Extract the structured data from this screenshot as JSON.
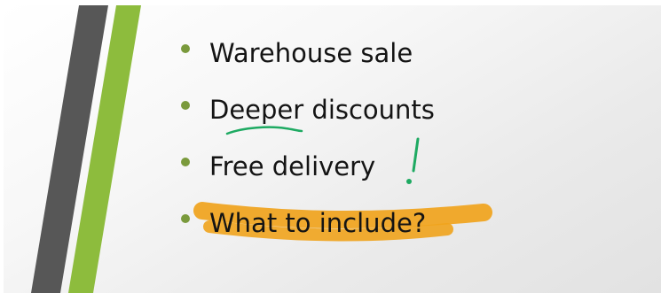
{
  "slide": {
    "bullets": [
      {
        "text": "Warehouse sale"
      },
      {
        "text": "Deeper discounts"
      },
      {
        "text": "Free delivery"
      },
      {
        "text": "What to include?"
      }
    ]
  },
  "colors": {
    "bullet": "#7a9a3c",
    "stripe_dark": "#575757",
    "stripe_green": "#8dbc3d",
    "annotation_green": "#1eaa62",
    "highlight": "#f0a31c"
  }
}
